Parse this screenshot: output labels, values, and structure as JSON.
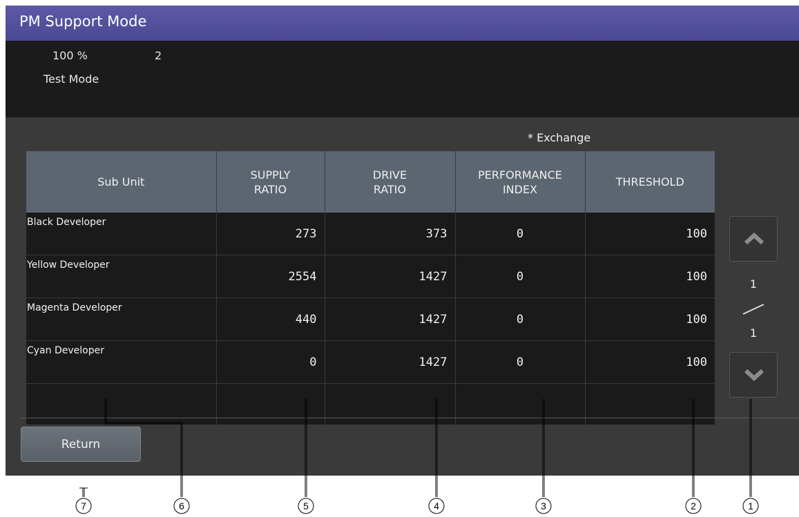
{
  "header": {
    "title": "PM Support Mode"
  },
  "info": {
    "percent": "100 %",
    "count": "2",
    "mode": "Test Mode"
  },
  "exchange_note": "* Exchange",
  "table": {
    "columns": [
      {
        "label": "Sub Unit"
      },
      {
        "label": "SUPPLY\nRATIO"
      },
      {
        "label": "DRIVE\nRATIO"
      },
      {
        "label": "PERFORMANCE\nINDEX"
      },
      {
        "label": "THRESHOLD"
      }
    ],
    "rows": [
      {
        "name": "Black Developer",
        "supply": "273",
        "drive": "373",
        "performance": "0",
        "threshold": "100"
      },
      {
        "name": "Yellow Developer",
        "supply": "2554",
        "drive": "1427",
        "performance": "0",
        "threshold": "100"
      },
      {
        "name": "Magenta Developer",
        "supply": "440",
        "drive": "1427",
        "performance": "0",
        "threshold": "100"
      },
      {
        "name": "Cyan Developer",
        "supply": "0",
        "drive": "1427",
        "performance": "0",
        "threshold": "100"
      }
    ]
  },
  "pager": {
    "current": "1",
    "total": "1",
    "up_icon": "chevron-up-icon",
    "down_icon": "chevron-down-icon"
  },
  "return_label": "Return",
  "callouts": [
    "1",
    "2",
    "3",
    "4",
    "5",
    "6",
    "7"
  ]
}
